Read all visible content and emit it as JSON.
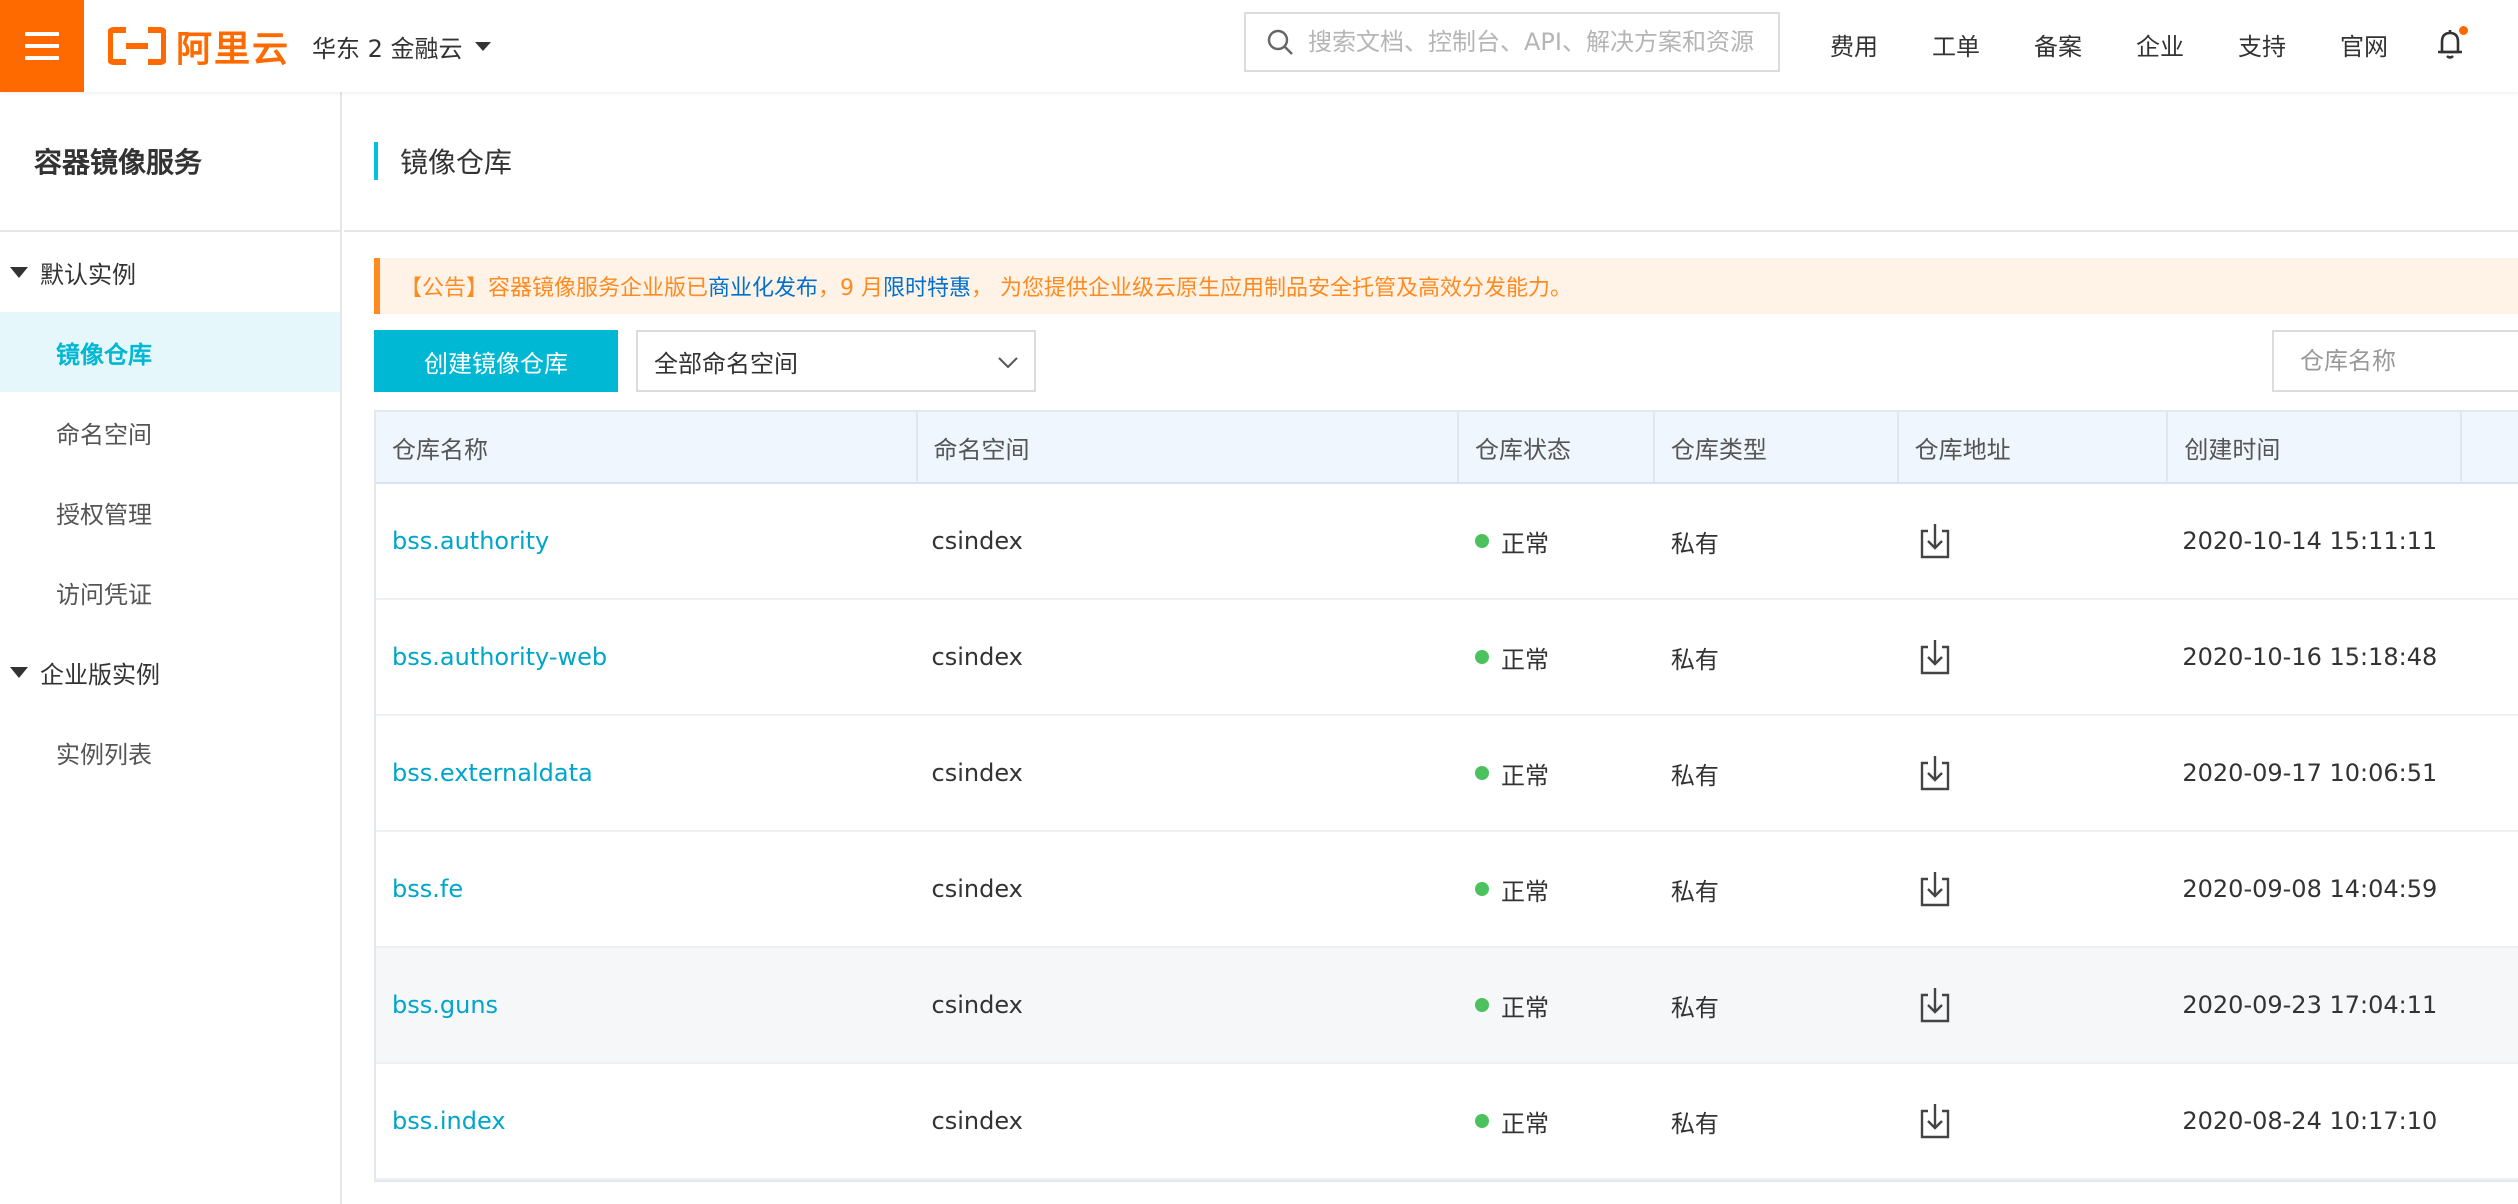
{
  "header": {
    "logo_text": "阿里云",
    "region": "华东 2 金融云",
    "search_placeholder": "搜索文档、控制台、API、解决方案和资源",
    "nav": [
      "费用",
      "工单",
      "备案",
      "企业",
      "支持",
      "官网"
    ],
    "brand_color": "#ff6a00"
  },
  "sidebar": {
    "title": "容器镜像服务",
    "groups": [
      {
        "label": "默认实例",
        "items": [
          {
            "label": "镜像仓库",
            "active": true
          },
          {
            "label": "命名空间"
          },
          {
            "label": "授权管理"
          },
          {
            "label": "访问凭证"
          }
        ]
      },
      {
        "label": "企业版实例",
        "items": [
          {
            "label": "实例列表"
          }
        ]
      }
    ]
  },
  "main": {
    "page_title": "镜像仓库",
    "notice": {
      "prefix": "【公告】容器镜像服务企业版已",
      "link1": "商业化发布",
      "middle": "，9 月",
      "link2": "限时特惠",
      "suffix": "， 为您提供企业级云原生应用制品安全托管及高效分发能力。"
    },
    "create_button": "创建镜像仓库",
    "namespace_select": "全部命名空间",
    "repo_search_placeholder": "仓库名称",
    "accent_color": "#00b8d4",
    "table": {
      "columns": [
        "仓库名称",
        "命名空间",
        "仓库状态",
        "仓库类型",
        "仓库地址",
        "创建时间",
        ""
      ],
      "rows": [
        {
          "name": "bss.authority",
          "namespace": "csindex",
          "status": "正常",
          "type": "私有",
          "created": "2020-10-14 15:11:11"
        },
        {
          "name": "bss.authority-web",
          "namespace": "csindex",
          "status": "正常",
          "type": "私有",
          "created": "2020-10-16 15:18:48"
        },
        {
          "name": "bss.externaldata",
          "namespace": "csindex",
          "status": "正常",
          "type": "私有",
          "created": "2020-09-17 10:06:51"
        },
        {
          "name": "bss.fe",
          "namespace": "csindex",
          "status": "正常",
          "type": "私有",
          "created": "2020-09-08 14:04:59"
        },
        {
          "name": "bss.guns",
          "namespace": "csindex",
          "status": "正常",
          "type": "私有",
          "created": "2020-09-23 17:04:11"
        },
        {
          "name": "bss.index",
          "namespace": "csindex",
          "status": "正常",
          "type": "私有",
          "created": "2020-08-24 10:17:10"
        }
      ]
    }
  }
}
